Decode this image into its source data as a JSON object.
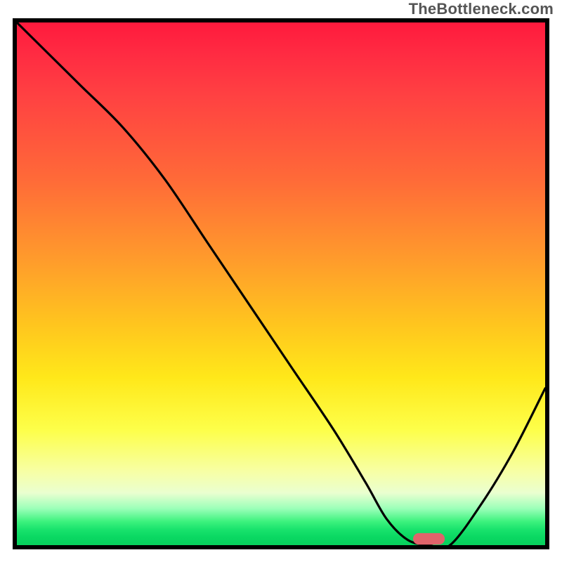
{
  "watermark": "TheBottleneck.com",
  "colors": {
    "frame": "#000000",
    "curve": "#000000",
    "marker": "#e0646b",
    "gradient_stops": [
      "#ff1a3d",
      "#ff4142",
      "#ff9a2c",
      "#ffe81a",
      "#f7ffa6",
      "#9bffb9",
      "#19e36d",
      "#07d05d"
    ]
  },
  "chart_data": {
    "type": "line",
    "title": "",
    "xlabel": "",
    "ylabel": "",
    "xlim": [
      0,
      100
    ],
    "ylim": [
      0,
      100
    ],
    "grid": false,
    "legend": null,
    "note": "Axes are unlabeled; values are read as percentages of the plot area (0 = left/bottom, 100 = right/top).",
    "series": [
      {
        "name": "bottleneck-curve",
        "x": [
          0,
          6,
          12,
          20,
          28,
          36,
          44,
          52,
          60,
          66,
          70,
          74,
          78,
          82,
          88,
          94,
          100
        ],
        "y": [
          100,
          94,
          88,
          80,
          70,
          58,
          46,
          34,
          22,
          12,
          5,
          1,
          0,
          0,
          8,
          18,
          30
        ]
      }
    ],
    "markers": [
      {
        "name": "optimal-range-pill",
        "x_center": 78,
        "y": 1.2,
        "width": 6,
        "height": 2.2,
        "shape": "rounded-rect"
      }
    ]
  }
}
